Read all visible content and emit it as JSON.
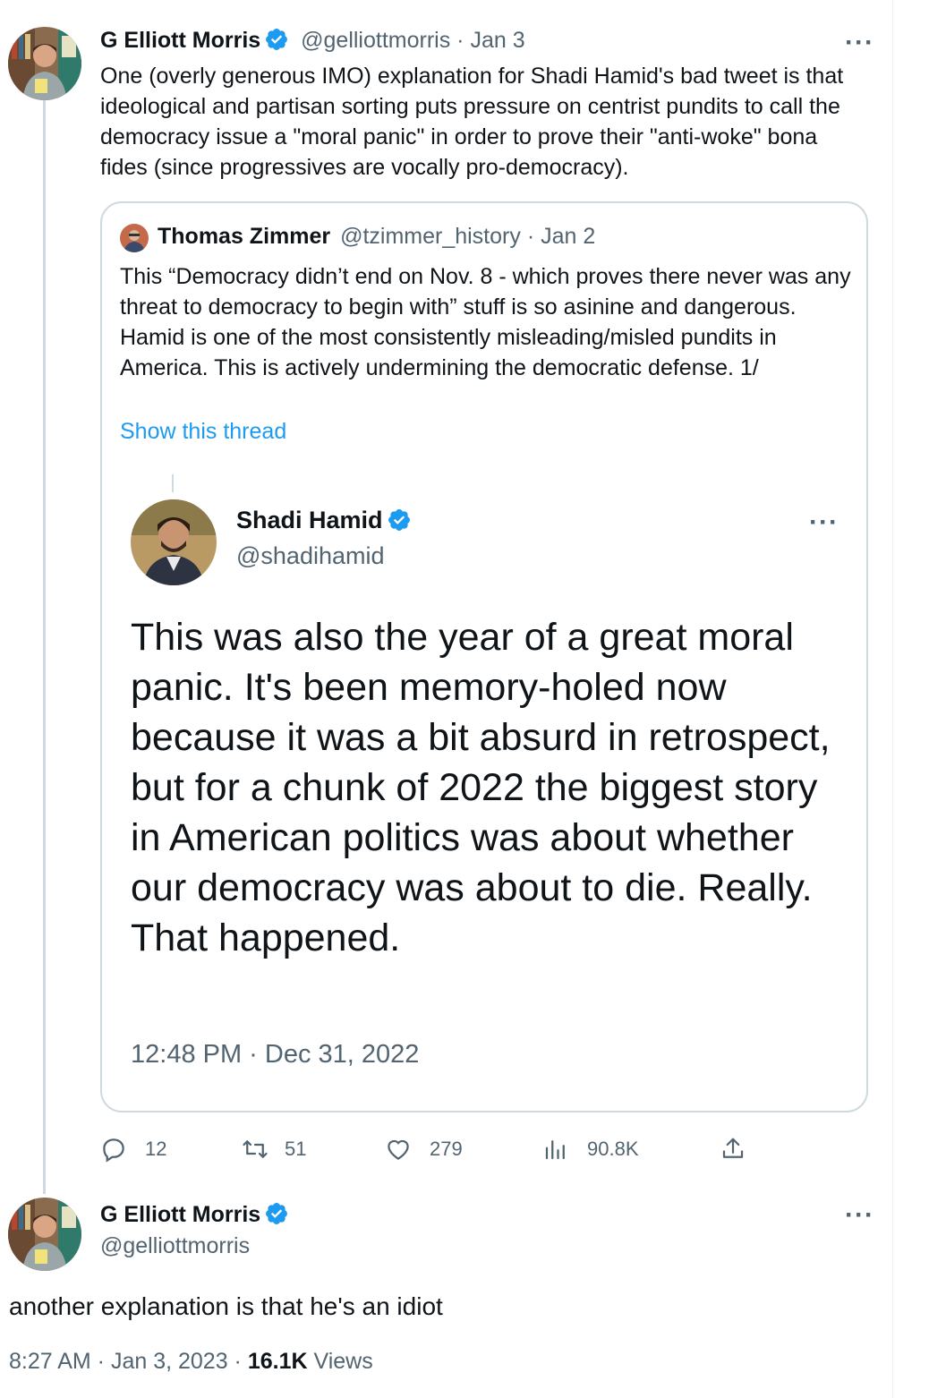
{
  "tweet1": {
    "name": "G Elliott Morris",
    "handle": "@gelliottmorris",
    "sep": "·",
    "date": "Jan 3",
    "text": "One (overly generous IMO) explanation for Shadi Hamid's bad tweet is that ideological and partisan sorting puts pressure on centrist pundits to call the democracy issue a \"moral panic\" in order to prove their \"anti-woke\" bona fides (since progressives are vocally pro-democracy).",
    "more_label": "···"
  },
  "quote": {
    "name": "Thomas Zimmer",
    "handle": "@tzimmer_history",
    "sep": "·",
    "date": "Jan 2",
    "text": "This “Democracy didn’t end on Nov. 8 - which proves there never was any threat to democracy to begin with” stuff is so asinine and dangerous. Hamid is one of the most consistently misleading/misled pundits in America. This is actively undermining the democratic defense. 1/",
    "show_thread": "Show this thread",
    "embedded": {
      "name": "Shadi Hamid",
      "handle": "@shadihamid",
      "more_label": "···",
      "text": "This was also the year of a great moral panic. It's been memory-holed now because it was a bit absurd in retrospect, but for a chunk of 2022 the biggest story in American politics was about whether our democracy was about to die. Really. That happened.",
      "timestamp": "12:48 PM · Dec 31, 2022"
    }
  },
  "actions": {
    "replies": "12",
    "retweets": "51",
    "likes": "279",
    "views": "90.8K"
  },
  "tweet2": {
    "name": "G Elliott Morris",
    "handle": "@gelliottmorris",
    "more_label": "···",
    "text": "another explanation is that he's an idiot",
    "time": "8:27 AM · Jan 3, 2023 · ",
    "views_count": "16.1K",
    "views_label": " Views"
  },
  "colors": {
    "accent": "#1d9bf0",
    "muted": "#536471",
    "border": "#cfd9de",
    "text": "#0f1419"
  }
}
